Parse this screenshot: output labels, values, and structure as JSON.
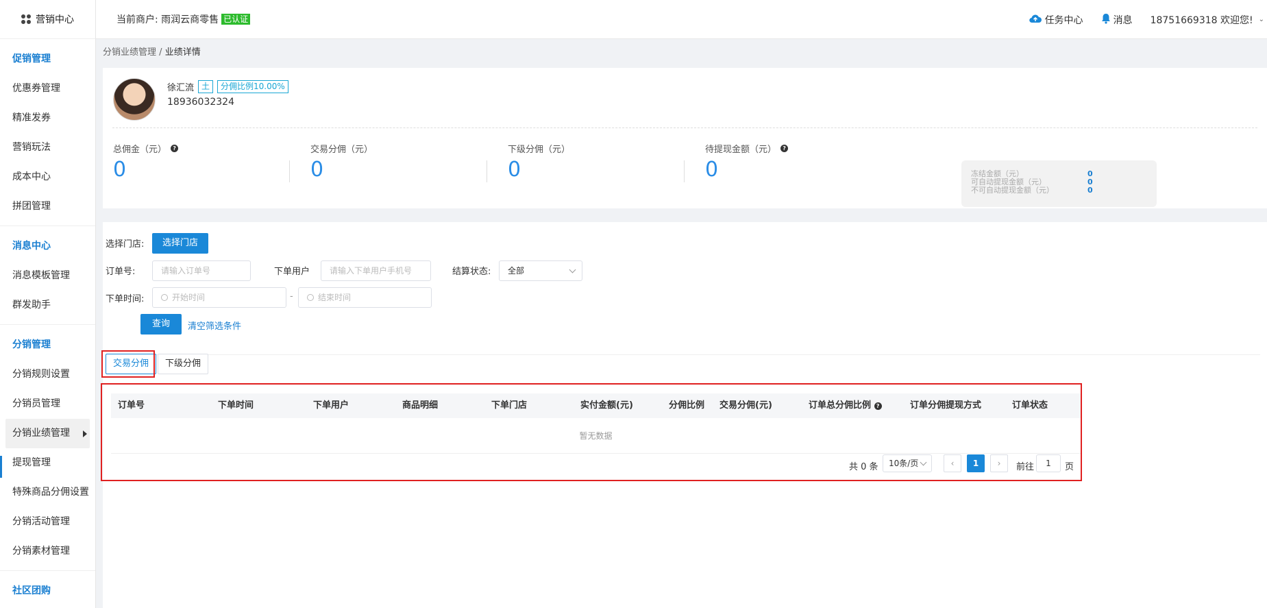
{
  "sidebar": {
    "brand": "营销中心",
    "sections": [
      {
        "title": "促销管理",
        "items": [
          "优惠券管理",
          "精准发券",
          "营销玩法",
          "成本中心",
          "拼团管理"
        ]
      },
      {
        "title": "消息中心",
        "items": [
          "消息模板管理",
          "群发助手"
        ]
      },
      {
        "title": "分销管理",
        "items": [
          "分销规则设置",
          "分销员管理",
          "分销业绩管理",
          "提现管理",
          "特殊商品分佣设置",
          "分销活动管理",
          "分销素材管理"
        ]
      },
      {
        "title": "社区团购",
        "items": []
      }
    ],
    "active_item": "分销业绩管理"
  },
  "header": {
    "merchant_label": "当前商户: 雨润云商零售",
    "verified": "已认证",
    "task_center": "任务中心",
    "messages": "消息",
    "user": "18751669318 欢迎您!"
  },
  "breadcrumb": {
    "parent": "分销业绩管理",
    "sep": "/",
    "current": "业绩详情"
  },
  "profile": {
    "name": "徐汇流",
    "tag_level": "土",
    "tag_ratio": "分佣比例10.00%",
    "phone": "18936032324"
  },
  "stats": [
    {
      "label": "总佣金（元）",
      "value": "0",
      "help": true
    },
    {
      "label": "交易分佣（元）",
      "value": "0",
      "help": false
    },
    {
      "label": "下级分佣（元）",
      "value": "0",
      "help": false
    },
    {
      "label": "待提现金额（元）",
      "value": "0",
      "help": true
    }
  ],
  "frozen": [
    {
      "label": "冻结金额（元）",
      "value": "0"
    },
    {
      "label": "可自动提现金额（元）",
      "value": "0"
    },
    {
      "label": "不可自动提现金额（元）",
      "value": "0"
    }
  ],
  "filters": {
    "store_label": "选择门店:",
    "store_button": "选择门店",
    "order_label": "订单号:",
    "order_placeholder": "请输入订单号",
    "user_label": "下单用户",
    "user_placeholder": "请输入下单用户手机号",
    "status_label": "结算状态:",
    "status_value": "全部",
    "time_label": "下单时间:",
    "start_placeholder": "开始时间",
    "range_sep": "-",
    "end_placeholder": "结束时间",
    "query_button": "查询",
    "clear_link": "清空筛选条件"
  },
  "tabs": [
    "交易分佣",
    "下级分佣"
  ],
  "table": {
    "columns": [
      "订单号",
      "下单时间",
      "下单用户",
      "商品明细",
      "下单门店",
      "实付金额(元)",
      "分佣比例",
      "交易分佣(元)",
      "订单总分佣比例",
      "订单分佣提现方式",
      "订单状态"
    ],
    "empty_text": "暂无数据"
  },
  "pagination": {
    "total": "共 0 条",
    "page_size": "10条/页",
    "current_page": "1",
    "goto_label": "前往",
    "goto_value": "1",
    "page_suffix": "页"
  },
  "colors": {
    "accent": "#1a88d8",
    "value_blue": "#2b8de6",
    "verified_green": "#2dbb2d",
    "highlight_red": "#e02020"
  }
}
